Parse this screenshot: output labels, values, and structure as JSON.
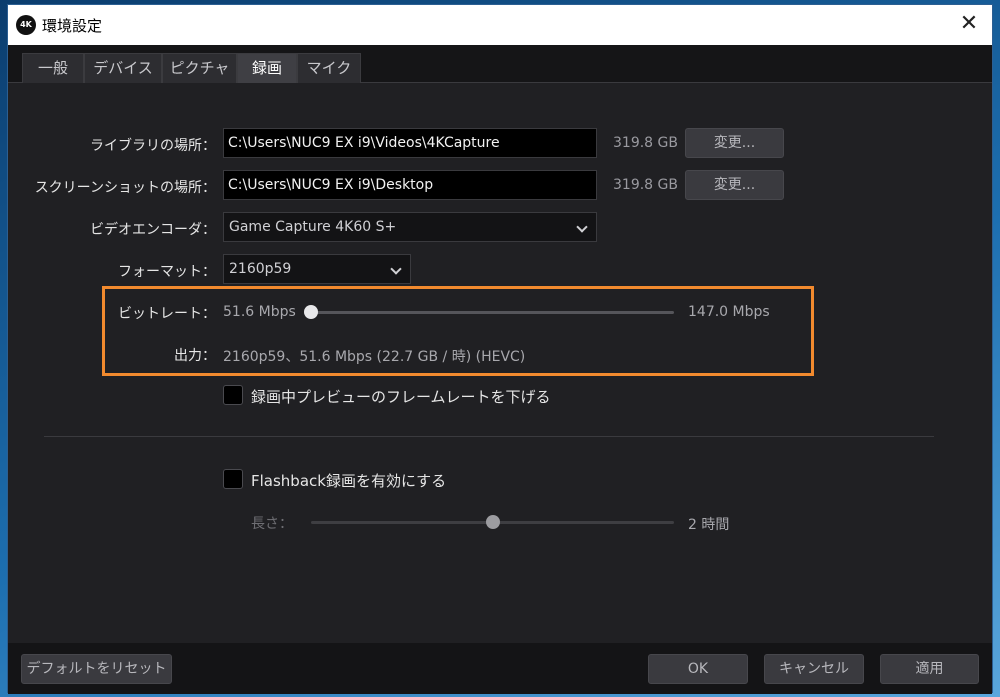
{
  "window": {
    "app_icon_text": "4K",
    "title": "環境設定"
  },
  "tabs": [
    "一般",
    "デバイス",
    "ピクチャ",
    "録画",
    "マイク"
  ],
  "library": {
    "label": "ライブラリの場所：",
    "path": "C:\\Users\\NUC9 EX i9\\Videos\\4KCapture",
    "size": "319.8 GB",
    "change_label": "変更..."
  },
  "screenshot": {
    "label": "スクリーンショットの場所：",
    "path": "C:\\Users\\NUC9 EX i9\\Desktop",
    "size": "319.8 GB",
    "change_label": "変更..."
  },
  "encoder": {
    "label": "ビデオエンコーダ：",
    "value": "Game Capture 4K60 S+"
  },
  "format": {
    "label": "フォーマット：",
    "value": "2160p59"
  },
  "bitrate": {
    "label": "ビットレート：",
    "min_text": "51.6 Mbps",
    "max_text": "147.0 Mbps",
    "level": 0
  },
  "output": {
    "label": "出力：",
    "value": "2160p59、51.6 Mbps (22.7 GB / 時) (HEVC)"
  },
  "preview_checkbox": {
    "label": "録画中プレビューのフレームレートを下げる",
    "checked": false
  },
  "flashback": {
    "checkbox_label": "Flashback録画を有効にする",
    "checked": false,
    "length_label": "長さ：",
    "length_value_text": "2 時間",
    "level": 0.5
  },
  "footer": {
    "reset_label": "デフォルトをリセット",
    "ok_label": "OK",
    "cancel_label": "キャンセル",
    "apply_label": "適用"
  },
  "colors": {
    "highlight": "#f28a2e",
    "window_bg": "#202023",
    "active_tab": "#3f3f44"
  }
}
